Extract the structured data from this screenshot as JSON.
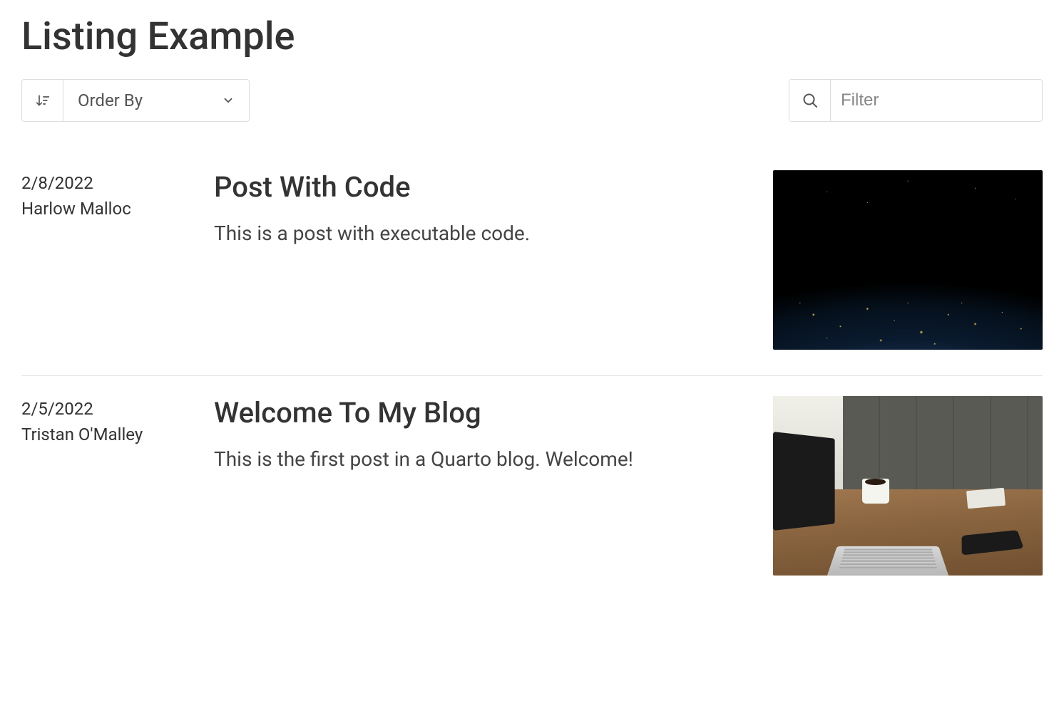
{
  "page": {
    "title": "Listing Example"
  },
  "controls": {
    "order_by_label": "Order By",
    "filter_placeholder": "Filter"
  },
  "posts": [
    {
      "date": "2/8/2022",
      "author": "Harlow Malloc",
      "title": "Post With Code",
      "description": "This is a post with executable code.",
      "thumb": "earth"
    },
    {
      "date": "2/5/2022",
      "author": "Tristan O'Malley",
      "title": "Welcome To My Blog",
      "description": "This is the first post in a Quarto blog. Welcome!",
      "thumb": "desk"
    }
  ]
}
